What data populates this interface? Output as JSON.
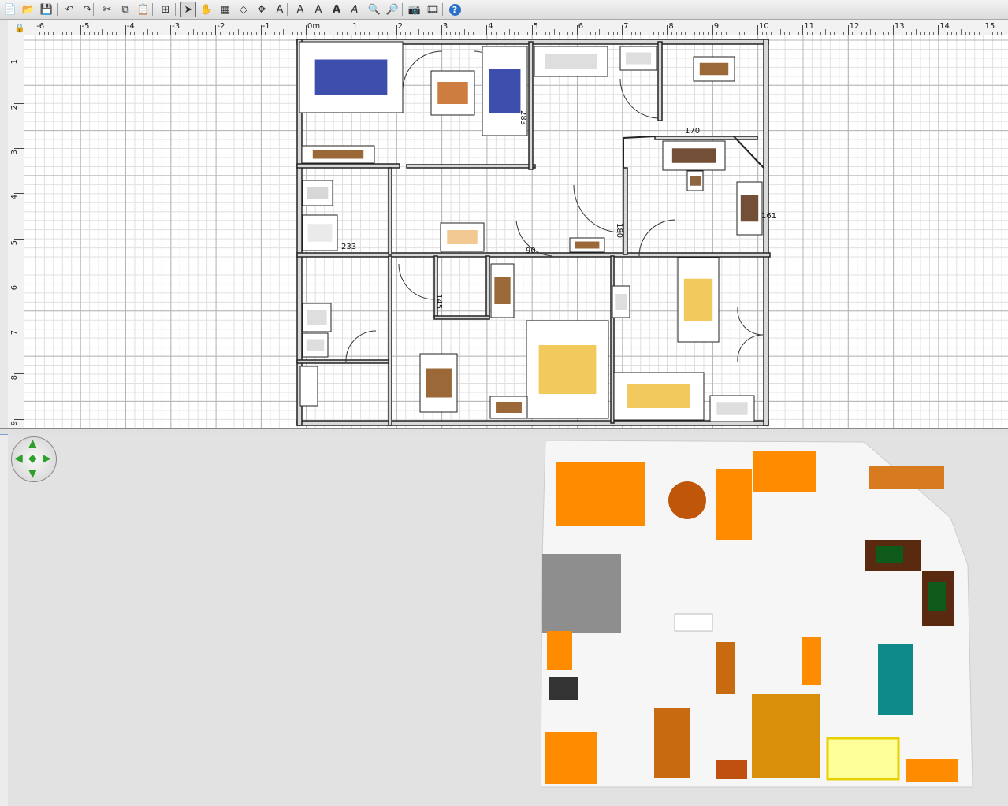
{
  "toolbar": {
    "buttons": [
      {
        "name": "new-home-button",
        "icon": "new-document-icon",
        "glyph": "📄"
      },
      {
        "name": "open-button",
        "icon": "folder-open-icon",
        "glyph": "📂"
      },
      {
        "name": "save-button",
        "icon": "save-icon",
        "glyph": "💾"
      },
      {
        "name": "undo-button",
        "icon": "undo-icon",
        "glyph": "↶"
      },
      {
        "name": "redo-button",
        "icon": "redo-icon",
        "glyph": "↷"
      },
      {
        "name": "cut-button",
        "icon": "scissors-icon",
        "glyph": "✂"
      },
      {
        "name": "copy-button",
        "icon": "copy-icon",
        "glyph": "⧉"
      },
      {
        "name": "paste-button",
        "icon": "clipboard-icon",
        "glyph": "📋"
      },
      {
        "name": "add-furniture-button",
        "icon": "add-furniture-icon",
        "glyph": "⊞"
      },
      {
        "name": "select-mode-button",
        "icon": "arrow-pointer-icon",
        "glyph": "➤"
      },
      {
        "name": "pan-mode-button",
        "icon": "hand-icon",
        "glyph": "✋"
      },
      {
        "name": "create-walls-button",
        "icon": "wall-icon",
        "glyph": "▦"
      },
      {
        "name": "create-rooms-button",
        "icon": "room-icon",
        "glyph": "◇"
      },
      {
        "name": "create-dimensions-button",
        "icon": "dimension-icon",
        "glyph": "✥"
      },
      {
        "name": "add-text-button",
        "icon": "text-icon",
        "glyph": "A"
      },
      {
        "name": "modify-text-style-button",
        "icon": "text-style-icon",
        "glyph": "A"
      },
      {
        "name": "increase-text-size-button",
        "icon": "text-size-increase-icon",
        "glyph": "A"
      },
      {
        "name": "bold-text-button",
        "icon": "bold-icon",
        "glyph": "A"
      },
      {
        "name": "italic-text-button",
        "icon": "italic-icon",
        "glyph": "A"
      },
      {
        "name": "zoom-in-button",
        "icon": "zoom-in-icon",
        "glyph": "🔍"
      },
      {
        "name": "zoom-out-button",
        "icon": "zoom-out-icon",
        "glyph": "🔎"
      },
      {
        "name": "create-photo-button",
        "icon": "camera-icon",
        "glyph": "📷"
      },
      {
        "name": "create-video-button",
        "icon": "video-icon",
        "glyph": "🎞"
      },
      {
        "name": "help-button",
        "icon": "help-icon",
        "glyph": "?"
      }
    ],
    "active": "select-mode-button"
  },
  "plan": {
    "ruler_x_labels": [
      "-6",
      "-5",
      "-4",
      "-3",
      "-2",
      "-1",
      "0m",
      "1",
      "2",
      "3",
      "4",
      "5",
      "6",
      "7",
      "8",
      "9",
      "10",
      "11",
      "12",
      "13",
      "14",
      "15"
    ],
    "ruler_y_labels": [
      "1",
      "2",
      "3",
      "4",
      "5",
      "6",
      "7",
      "8",
      "9"
    ],
    "dimension_labels": [
      "283",
      "170",
      "180",
      "90",
      "145",
      "233",
      "161"
    ],
    "lock_icon": "padlock-icon"
  },
  "view3d": {
    "navigation_icon": "navigation-arrows-icon"
  },
  "colors": {
    "grid_major": "#b4b4b4",
    "grid_minor": "#e0e0e0",
    "wall_fill": "#d9d9d9",
    "furniture_orange": "#ff8c00",
    "background_3d": "#e2e2e2"
  }
}
